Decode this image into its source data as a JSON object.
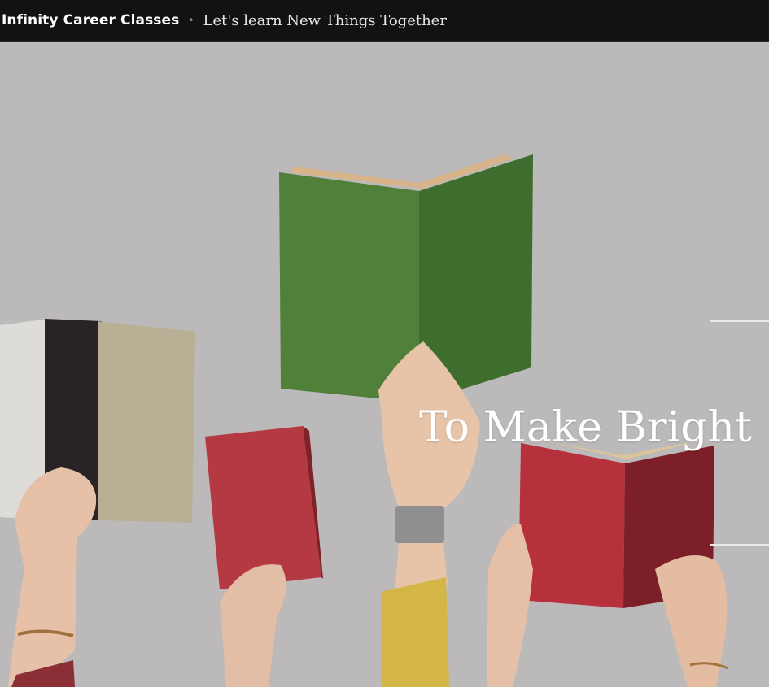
{
  "header": {
    "site_title": "Infinity Career Classes",
    "separator": "•",
    "tagline": "Let's learn New Things Together"
  },
  "hero": {
    "headline": "To Make Bright"
  },
  "colors": {
    "topbar": "#121212",
    "background": "#bcb9ba",
    "green_book": "#4f7c39",
    "red_book": "#b83640",
    "yellow_sleeve": "#d6b84a"
  }
}
